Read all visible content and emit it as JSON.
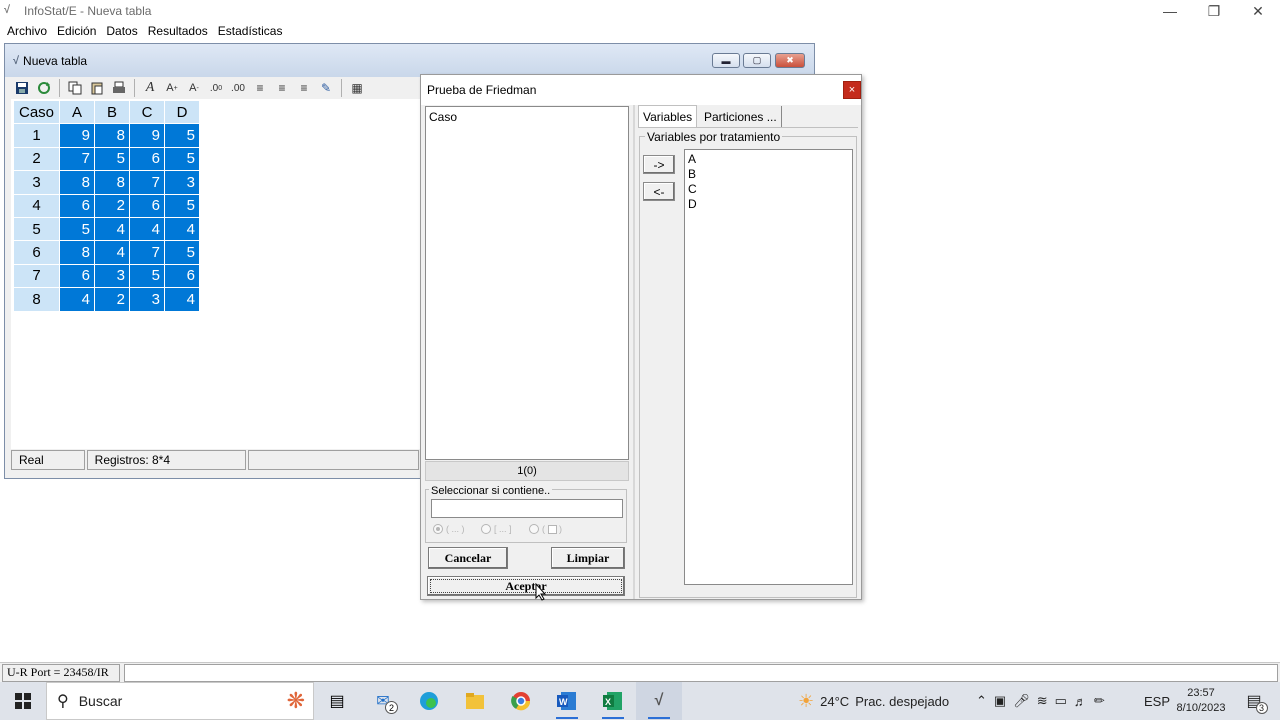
{
  "app": {
    "title": "InfoStat/E - Nueva tabla",
    "menu": [
      "Archivo",
      "Edición",
      "Datos",
      "Resultados",
      "Estadísticas"
    ]
  },
  "table_window": {
    "title": "Nueva tabla",
    "columns": [
      "Caso",
      "A",
      "B",
      "C",
      "D"
    ],
    "rows": [
      [
        "1",
        "9",
        "8",
        "9",
        "5"
      ],
      [
        "2",
        "7",
        "5",
        "6",
        "5"
      ],
      [
        "3",
        "8",
        "8",
        "7",
        "3"
      ],
      [
        "4",
        "6",
        "2",
        "6",
        "5"
      ],
      [
        "5",
        "5",
        "4",
        "4",
        "4"
      ],
      [
        "6",
        "8",
        "4",
        "7",
        "5"
      ],
      [
        "7",
        "6",
        "3",
        "5",
        "6"
      ],
      [
        "8",
        "4",
        "2",
        "3",
        "4"
      ]
    ],
    "status": {
      "mode": "Real",
      "records": "Registros: 8*4"
    }
  },
  "dialog": {
    "title": "Prueba de Friedman",
    "close": "×",
    "source_list": [
      "Caso"
    ],
    "selection_count": "1(0)",
    "filter_label": "Seleccionar si contiene..",
    "filter_value": "",
    "tabs": [
      "Variables",
      "Particiones ..."
    ],
    "group_label": "Variables por tratamiento",
    "add_arrow": "->",
    "remove_arrow": "<-",
    "target_list": [
      "A",
      "B",
      "C",
      "D"
    ],
    "cancel_label": "Cancelar",
    "clear_label": "Limpiar",
    "accept_label": "Aceptar"
  },
  "bottom_bar": {
    "port": "U-R Port = 23458/IR"
  },
  "taskbar": {
    "search_placeholder": "Buscar",
    "mail_badge": "2",
    "weather": {
      "temp": "24°C",
      "desc": "Prac. despejado"
    },
    "lang": "ESP",
    "time": "23:57",
    "date": "8/10/2023",
    "notifications": "3"
  },
  "colors": {
    "selection": "#0078d7",
    "header": "#cce4f7",
    "close_red": "#c42b1c"
  }
}
